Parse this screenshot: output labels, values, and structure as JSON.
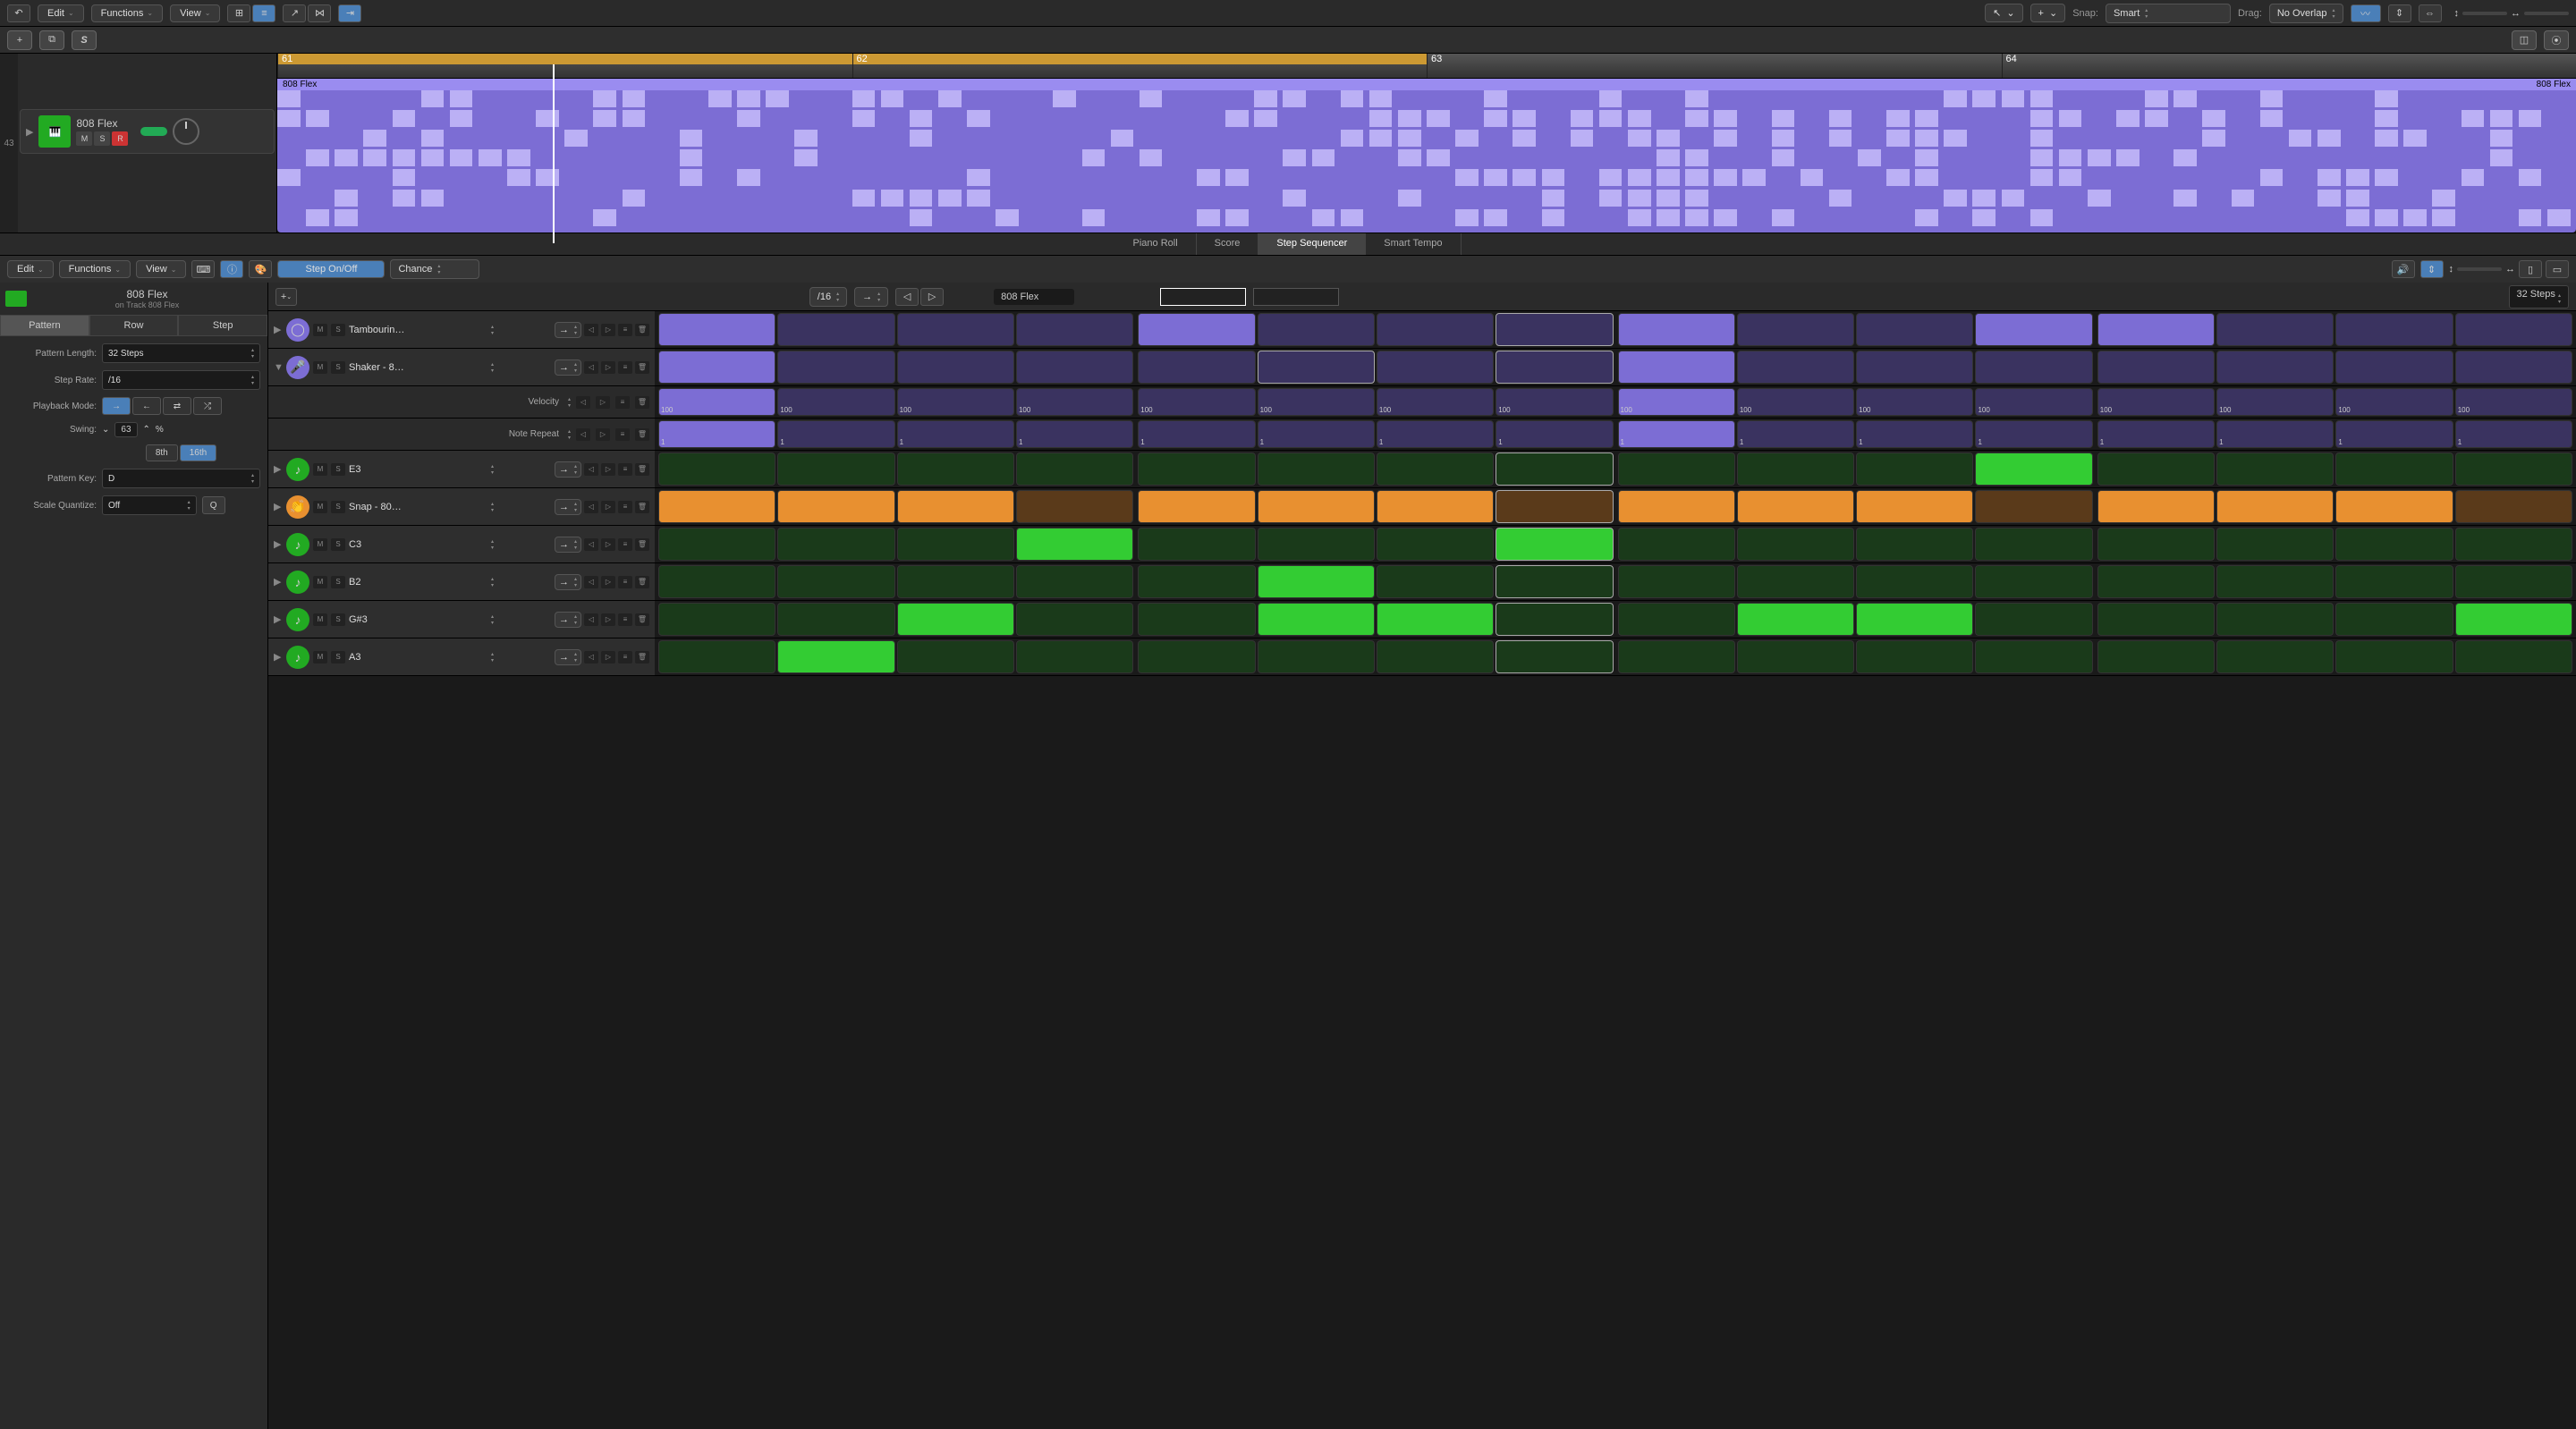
{
  "top_menu": {
    "edit": "Edit",
    "functions": "Functions",
    "view": "View"
  },
  "snap_label": "Snap:",
  "snap_value": "Smart",
  "drag_label": "Drag:",
  "drag_value": "No Overlap",
  "track_number": "43",
  "track": {
    "name": "808 Flex",
    "m": "M",
    "s": "S",
    "r": "R"
  },
  "ruler": [
    "61",
    "62",
    "63",
    "64"
  ],
  "region_name": "808 Flex",
  "editor_tabs": {
    "piano": "Piano Roll",
    "score": "Score",
    "step": "Step Sequencer",
    "tempo": "Smart Tempo"
  },
  "ed_menu": {
    "edit": "Edit",
    "functions": "Functions",
    "view": "View"
  },
  "step_onoff": "Step On/Off",
  "chance": "Chance",
  "seq_title": "808 Flex",
  "seq_subtitle": "on Track 808 Flex",
  "left_tabs": {
    "pattern": "Pattern",
    "row": "Row",
    "step": "Step"
  },
  "settings": {
    "pattern_length_label": "Pattern Length:",
    "pattern_length": "32 Steps",
    "step_rate_label": "Step Rate:",
    "step_rate": "/16",
    "playback_mode_label": "Playback Mode:",
    "swing_label": "Swing:",
    "swing_value": "63",
    "swing_pct": "%",
    "eighth": "8th",
    "sixteenth": "16th",
    "pattern_key_label": "Pattern Key:",
    "pattern_key": "D",
    "scale_quantize_label": "Scale Quantize:",
    "scale_quantize": "Off"
  },
  "seq_rate": "/16",
  "pattern_name": "808 Flex",
  "steps_count": "32 Steps",
  "rows": [
    {
      "icon": "tamb",
      "name": "Tambourin…",
      "color": "purple",
      "cells": [
        1,
        0,
        0,
        0,
        1,
        0,
        0,
        2,
        1,
        0,
        0,
        1,
        1,
        0,
        0,
        0
      ]
    },
    {
      "icon": "shaker",
      "name": "Shaker - 8…",
      "color": "purple",
      "expanded": true,
      "cells": [
        1,
        0,
        0,
        0,
        0,
        2,
        0,
        2,
        1,
        0,
        0,
        0,
        0,
        0,
        0,
        0
      ],
      "velocity": {
        "label": "Velocity",
        "vals": [
          "100",
          "100",
          "100",
          "100",
          "100",
          "100",
          "100",
          "100",
          "100",
          "100",
          "100",
          "100",
          "100",
          "100",
          "100",
          "100"
        ],
        "on": [
          1,
          0,
          0,
          0,
          0,
          0,
          0,
          0,
          1,
          0,
          0,
          0,
          0,
          0,
          0,
          0
        ]
      },
      "repeat": {
        "label": "Note Repeat",
        "vals": [
          "1",
          "1",
          "1",
          "1",
          "1",
          "1",
          "1",
          "1",
          "1",
          "1",
          "1",
          "1",
          "1",
          "1",
          "1",
          "1"
        ],
        "on": [
          1,
          0,
          0,
          0,
          0,
          0,
          0,
          0,
          1,
          0,
          0,
          0,
          0,
          0,
          0,
          0
        ]
      }
    },
    {
      "icon": "note",
      "name": "E3",
      "color": "green",
      "cells": [
        0,
        0,
        0,
        0,
        0,
        0,
        0,
        2,
        0,
        0,
        0,
        1,
        0,
        0,
        0,
        0
      ]
    },
    {
      "icon": "snap",
      "name": "Snap - 80…",
      "color": "orange",
      "cells": [
        1,
        1,
        1,
        0,
        1,
        1,
        1,
        2,
        1,
        1,
        1,
        0,
        1,
        1,
        1,
        0
      ]
    },
    {
      "icon": "note",
      "name": "C3",
      "color": "green",
      "cells": [
        0,
        0,
        0,
        1,
        0,
        0,
        0,
        3,
        0,
        0,
        0,
        0,
        0,
        0,
        0,
        0
      ]
    },
    {
      "icon": "note",
      "name": "B2",
      "color": "green",
      "cells": [
        0,
        0,
        0,
        0,
        0,
        1,
        0,
        2,
        0,
        0,
        0,
        0,
        0,
        0,
        0,
        0
      ]
    },
    {
      "icon": "note",
      "name": "G#3",
      "color": "green",
      "cells": [
        0,
        0,
        1,
        0,
        0,
        1,
        1,
        2,
        0,
        1,
        1,
        0,
        0,
        0,
        0,
        1
      ]
    },
    {
      "icon": "note",
      "name": "A3",
      "color": "green",
      "cells": [
        0,
        1,
        0,
        0,
        0,
        0,
        0,
        2,
        0,
        0,
        0,
        0,
        0,
        0,
        0,
        0
      ]
    }
  ]
}
